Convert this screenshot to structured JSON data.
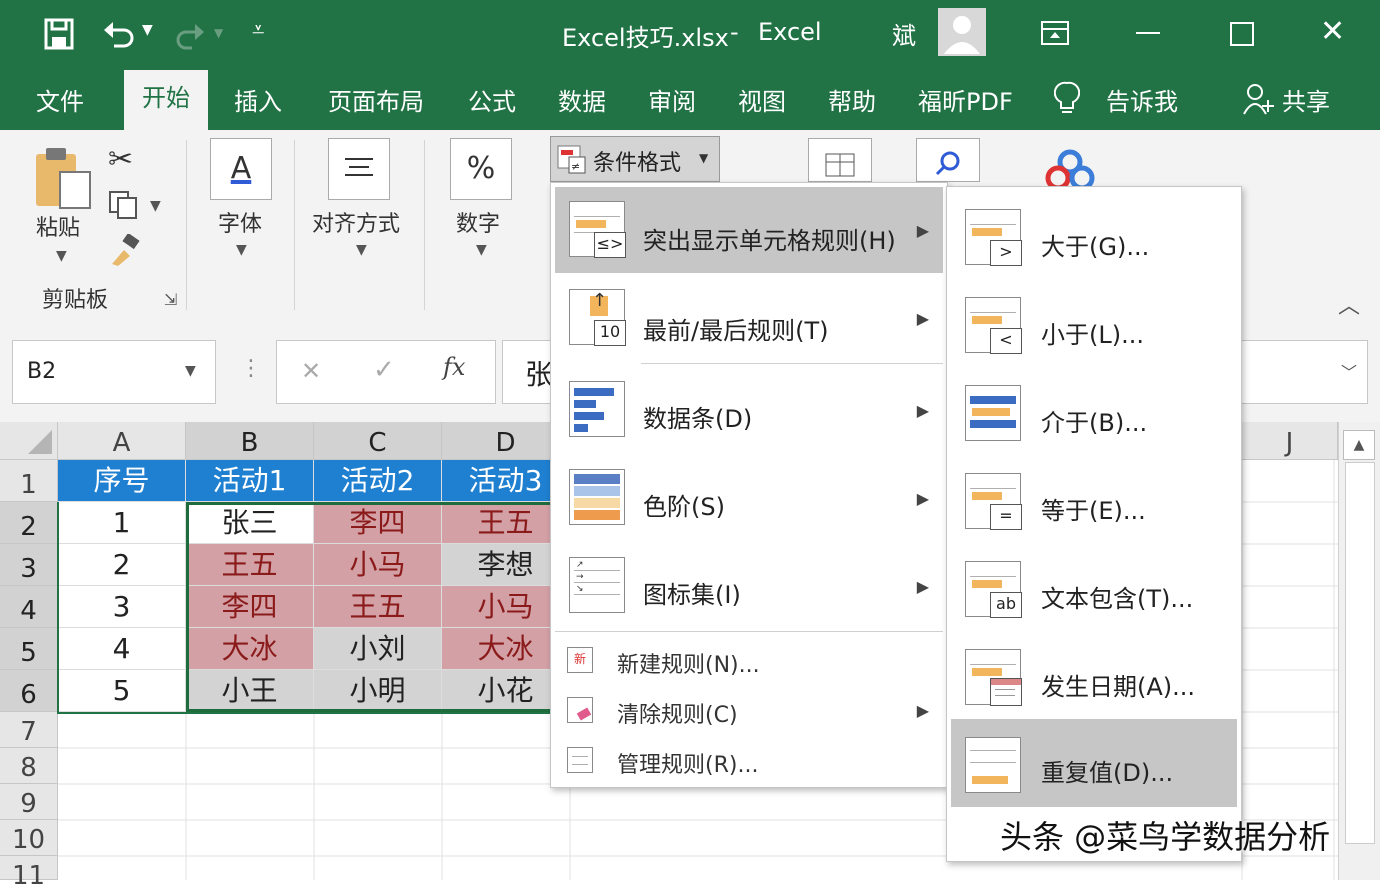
{
  "title": {
    "file": "Excel技巧.xlsx",
    "separator": "-",
    "app": "Excel",
    "user": "斌"
  },
  "tabs": [
    "文件",
    "开始",
    "插入",
    "页面布局",
    "公式",
    "数据",
    "审阅",
    "视图",
    "帮助",
    "福昕PDF",
    "告诉我",
    "共享"
  ],
  "ribbon": {
    "paste": "粘贴",
    "clipboard": "剪贴板",
    "font": "字体",
    "font_icon": "A",
    "align": "对齐方式",
    "number": "数字",
    "number_icon": "%",
    "conditional": "条件格式"
  },
  "formula": {
    "namebox": "B2",
    "cancel": "✕",
    "enter": "✓",
    "fx": "fx",
    "content": "张"
  },
  "columns": [
    "A",
    "B",
    "C",
    "D"
  ],
  "column_j": "J",
  "rows": [
    "1",
    "2",
    "3",
    "4",
    "5",
    "6",
    "7",
    "8",
    "9",
    "10",
    "11"
  ],
  "table": {
    "header": [
      "序号",
      "活动1",
      "活动2",
      "活动3"
    ],
    "body": [
      [
        "1",
        "张三",
        "李四",
        "王五"
      ],
      [
        "2",
        "王五",
        "小马",
        "李想"
      ],
      [
        "3",
        "李四",
        "王五",
        "小马"
      ],
      [
        "4",
        "大冰",
        "小刘",
        "大冰"
      ],
      [
        "5",
        "小王",
        "小明",
        "小花"
      ]
    ]
  },
  "menu_main": [
    {
      "label": "突出显示单元格规则(H)",
      "sub": "≤>"
    },
    {
      "label": "最前/最后规则(T)",
      "sub": "10"
    },
    {
      "label": "数据条(D)"
    },
    {
      "label": "色阶(S)"
    },
    {
      "label": "图标集(I)"
    }
  ],
  "menu_small": [
    "新建规则(N)...",
    "清除规则(C)",
    "管理规则(R)..."
  ],
  "menu_sub": [
    {
      "label": "大于(G)...",
      "sub": ">"
    },
    {
      "label": "小于(L)...",
      "sub": "<"
    },
    {
      "label": "介于(B)..."
    },
    {
      "label": "等于(E)...",
      "sub": "="
    },
    {
      "label": "文本包含(T)...",
      "sub": "ab"
    },
    {
      "label": "发生日期(A)..."
    },
    {
      "label": "重复值(D)..."
    }
  ],
  "watermark": "头条 @菜鸟学数据分析",
  "colors": {
    "excel_green": "#217346",
    "header_blue": "#1f7fd0",
    "dup_red_bg": "#d2a0a5",
    "dup_red_text": "#8b1a1a",
    "unique_gray": "#d3d3d3",
    "menu_highlight": "#c6c6c6"
  }
}
